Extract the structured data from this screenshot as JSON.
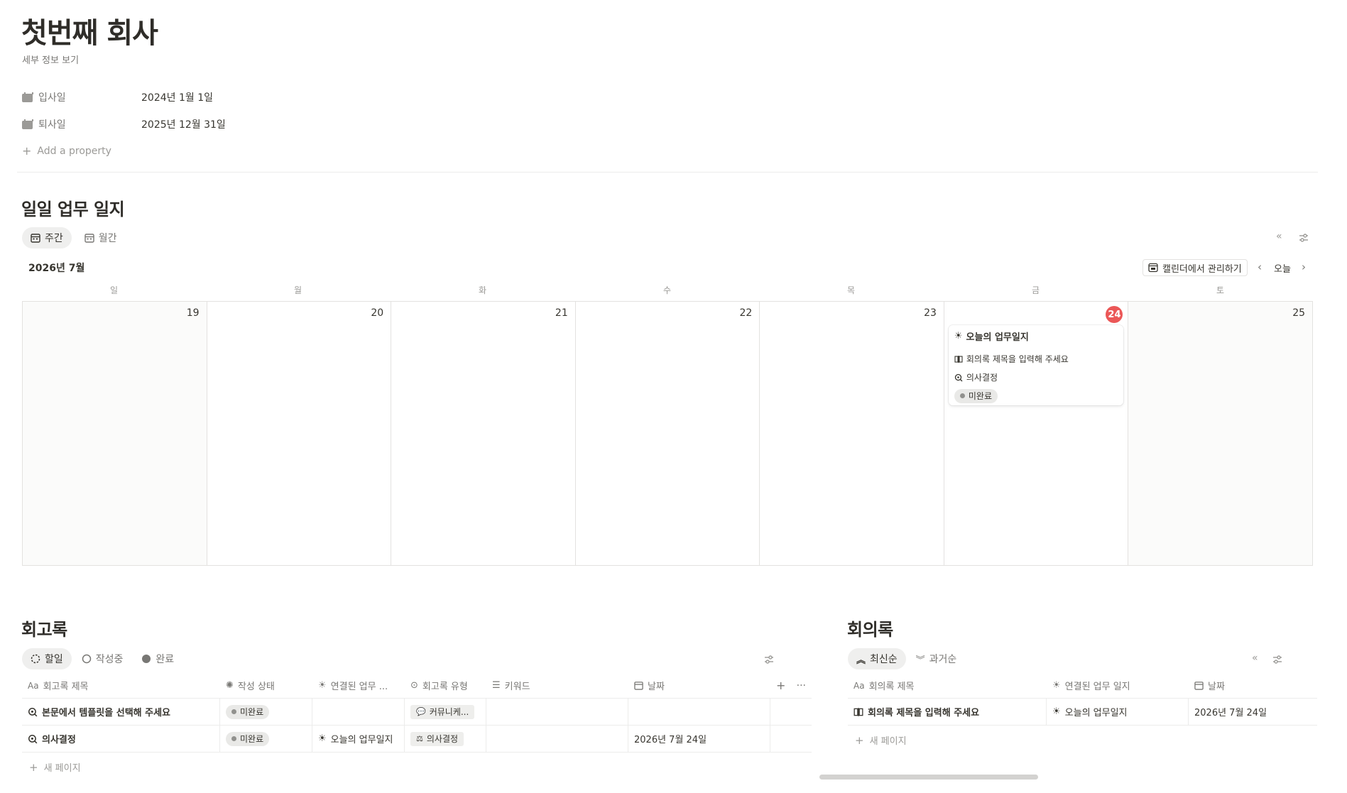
{
  "page": {
    "title": "첫번째 회사",
    "subtitle": "세부 정보 보기"
  },
  "properties": [
    {
      "label": "입사일",
      "value": "2024년 1월 1일"
    },
    {
      "label": "퇴사일",
      "value": "2025년 12월 31일"
    }
  ],
  "add_property": "Add a property",
  "daily_log": {
    "heading": "일일 업무 일지",
    "tabs": [
      "주간",
      "월간"
    ],
    "month": "2026년 7월",
    "manage_btn": "캘린더에서 관리하기",
    "today_btn": "오늘",
    "weekdays": [
      "일",
      "월",
      "화",
      "수",
      "목",
      "금",
      "토"
    ],
    "days": [
      "19",
      "20",
      "21",
      "22",
      "23",
      "24",
      "25"
    ],
    "event": {
      "title": "오늘의 업무일지",
      "meeting": "회의록 제목을 입력해 주세요",
      "retro": "의사결정",
      "status": "미완료"
    }
  },
  "retro": {
    "heading": "회고록",
    "tabs": [
      "할일",
      "작성중",
      "완료"
    ],
    "columns": [
      "회고록 제목",
      "작성 상태",
      "연결된 업무 ...",
      "회고록 유형",
      "키워드",
      "날짜"
    ],
    "rows": [
      {
        "title": "본문에서 템플릿을 선택해 주세요",
        "status": "미완료",
        "linked": "",
        "type": "커뮤니케...",
        "keyword": "",
        "date": ""
      },
      {
        "title": "의사결정",
        "status": "미완료",
        "linked": "오늘의 업무일지",
        "type": "의사결정",
        "keyword": "",
        "date": "2026년 7월 24일"
      }
    ],
    "new_page": "새 페이지"
  },
  "minutes": {
    "heading": "회의록",
    "tabs": [
      "최신순",
      "과거순"
    ],
    "columns": [
      "회의록 제목",
      "연결된 업무 일지",
      "날짜"
    ],
    "rows": [
      {
        "title": "회의록 제목을 입력해 주세요",
        "linked": "오늘의 업무일지",
        "date": "2026년 7월 24일"
      }
    ],
    "new_page": "새 페이지"
  },
  "colors": {
    "today_badge": "#eb5757",
    "text": "#37352f",
    "muted": "#787774"
  }
}
